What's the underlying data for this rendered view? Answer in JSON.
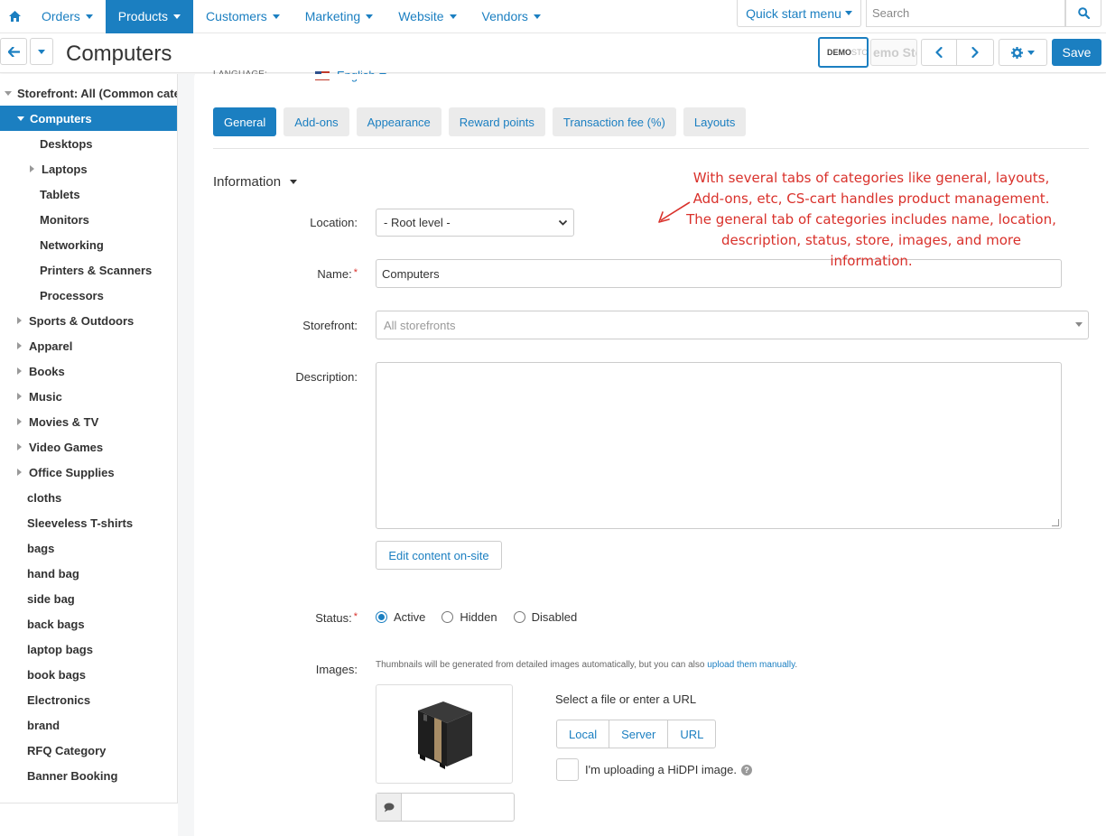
{
  "topnav": {
    "items": [
      {
        "label": "Orders",
        "active": false
      },
      {
        "label": "Products",
        "active": true
      },
      {
        "label": "Customers",
        "active": false
      },
      {
        "label": "Marketing",
        "active": false
      },
      {
        "label": "Website",
        "active": false
      },
      {
        "label": "Vendors",
        "active": false
      }
    ],
    "quick_start": "Quick start menu",
    "search_placeholder": "Search"
  },
  "header": {
    "title": "Computers",
    "demo_badge_bold": "DEMO",
    "demo_badge_faint": "STO",
    "demo_store_text": "emo Sto",
    "save_label": "Save"
  },
  "sidebar": {
    "items": [
      {
        "label": "Storefront: All (Common categories)",
        "indent": 1,
        "toggle": "down",
        "active": false
      },
      {
        "label": "Computers",
        "indent": 2,
        "toggle": "down",
        "active": true
      },
      {
        "label": "Desktops",
        "indent": 3,
        "toggle": "none",
        "active": false
      },
      {
        "label": "Laptops",
        "indent": 3,
        "toggle": "right",
        "active": false
      },
      {
        "label": "Tablets",
        "indent": 3,
        "toggle": "none",
        "active": false
      },
      {
        "label": "Monitors",
        "indent": 3,
        "toggle": "none",
        "active": false
      },
      {
        "label": "Networking",
        "indent": 3,
        "toggle": "none",
        "active": false
      },
      {
        "label": "Printers & Scanners",
        "indent": 3,
        "toggle": "none",
        "active": false
      },
      {
        "label": "Processors",
        "indent": 3,
        "toggle": "none",
        "active": false
      },
      {
        "label": "Sports & Outdoors",
        "indent": 2,
        "toggle": "right",
        "active": false
      },
      {
        "label": "Apparel",
        "indent": 2,
        "toggle": "right",
        "active": false
      },
      {
        "label": "Books",
        "indent": 2,
        "toggle": "right",
        "active": false
      },
      {
        "label": "Music",
        "indent": 2,
        "toggle": "right",
        "active": false
      },
      {
        "label": "Movies & TV",
        "indent": 2,
        "toggle": "right",
        "active": false
      },
      {
        "label": "Video Games",
        "indent": 2,
        "toggle": "right",
        "active": false
      },
      {
        "label": "Office Supplies",
        "indent": 2,
        "toggle": "right",
        "active": false
      },
      {
        "label": "cloths",
        "indent": 2,
        "toggle": "none",
        "active": false
      },
      {
        "label": "Sleeveless T-shirts",
        "indent": 2,
        "toggle": "none",
        "active": false
      },
      {
        "label": "bags",
        "indent": 2,
        "toggle": "none",
        "active": false
      },
      {
        "label": "hand bag",
        "indent": 2,
        "toggle": "none",
        "active": false
      },
      {
        "label": "side bag",
        "indent": 2,
        "toggle": "none",
        "active": false
      },
      {
        "label": "back bags",
        "indent": 2,
        "toggle": "none",
        "active": false
      },
      {
        "label": "laptop bags",
        "indent": 2,
        "toggle": "none",
        "active": false
      },
      {
        "label": "book bags",
        "indent": 2,
        "toggle": "none",
        "active": false
      },
      {
        "label": "Electronics",
        "indent": 2,
        "toggle": "none",
        "active": false
      },
      {
        "label": "brand",
        "indent": 2,
        "toggle": "none",
        "active": false
      },
      {
        "label": "RFQ Category",
        "indent": 2,
        "toggle": "none",
        "active": false
      },
      {
        "label": "Banner Booking",
        "indent": 2,
        "toggle": "none",
        "active": false
      }
    ]
  },
  "language": {
    "label": "LANGUAGE:",
    "value": "English"
  },
  "tabs": [
    {
      "label": "General",
      "active": true
    },
    {
      "label": "Add-ons",
      "active": false
    },
    {
      "label": "Appearance",
      "active": false
    },
    {
      "label": "Reward points",
      "active": false
    },
    {
      "label": "Transaction fee (%)",
      "active": false
    },
    {
      "label": "Layouts",
      "active": false
    }
  ],
  "form": {
    "section_title": "Information",
    "location_label": "Location:",
    "location_value": "- Root level -",
    "name_label": "Name:",
    "name_value": "Computers",
    "required_mark": "*",
    "storefront_label": "Storefront:",
    "storefront_placeholder": "All storefronts",
    "description_label": "Description:",
    "edit_content_label": "Edit content on-site",
    "status_label": "Status:",
    "status_options": [
      {
        "label": "Active",
        "checked": true
      },
      {
        "label": "Hidden",
        "checked": false
      },
      {
        "label": "Disabled",
        "checked": false
      }
    ],
    "images_label": "Images:",
    "images_note": "Thumbnails will be generated from detailed images automatically, but you can also ",
    "images_note_link": "upload them manually",
    "images_note_end": ".",
    "select_file_text": "Select a file or enter a URL",
    "upload_buttons": [
      "Local",
      "Server",
      "URL"
    ],
    "hidpi_label": "I'm uploading a HiDPI image."
  },
  "annotation": {
    "lines": [
      "With several tabs of categories like general, layouts,",
      "Add-ons, etc, CS-cart handles product management.",
      "The general tab of categories includes name, location,",
      "description, status, store,  images, and more",
      "information."
    ],
    "color": "#d9312b"
  },
  "colors": {
    "accent": "#1b7fc1",
    "required": "#d9312b"
  },
  "icons": {
    "home": "home-icon",
    "search": "search-icon",
    "back": "arrow-left-icon",
    "prev": "chevron-left-icon",
    "next": "chevron-right-icon",
    "gear": "gear-icon",
    "comment": "comment-icon",
    "help": "question-icon"
  }
}
